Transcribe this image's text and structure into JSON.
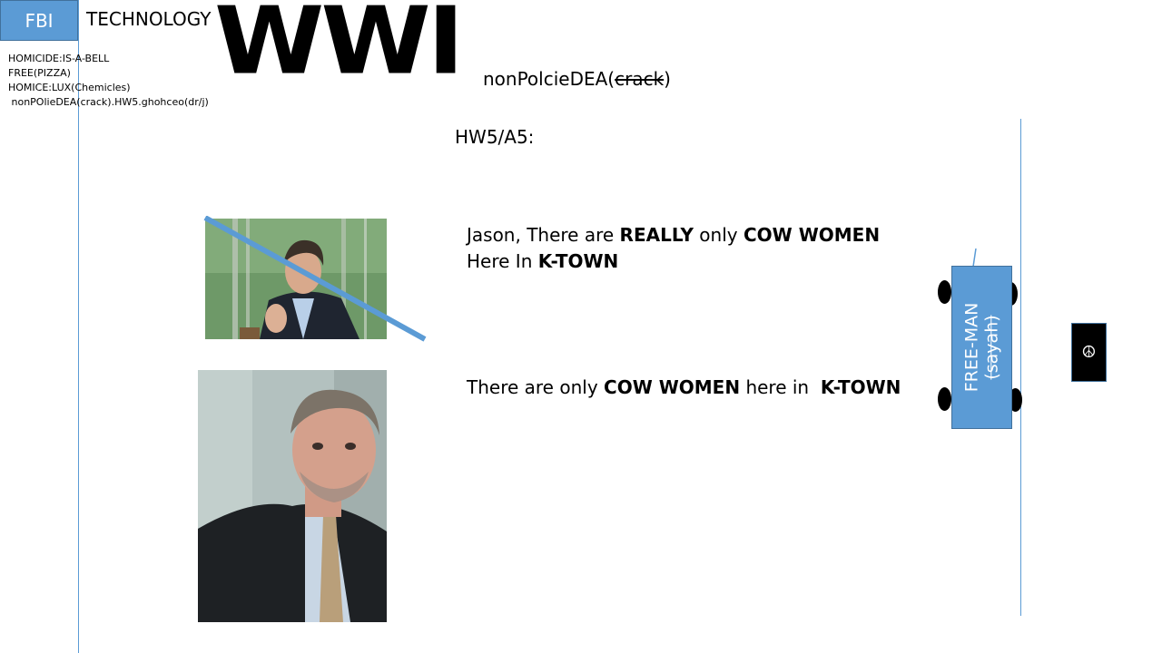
{
  "header": {
    "fbi_label": "FBI",
    "technology_label": "TECHNOLOGY",
    "big_title": "WWI"
  },
  "notes": [
    "HOMICIDE:IS-A-BELL",
    "FREE(PIZZA)",
    "HOMICE:LUX(Chemicles)",
    " nonPOlieDEA(crack).HW5.ghohceo(dr/j)"
  ],
  "dea_title": {
    "prefix": "nonPolcieDEA(",
    "struck": "crack",
    "suffix": ")"
  },
  "hw_title": "HW5/A5:",
  "message1": {
    "part1": "Jason, There are ",
    "bold1": "REALLY",
    "part2": " only ",
    "bold2": "COW WOMEN",
    "part3": " Here In ",
    "bold3": "K-TOWN"
  },
  "message2": {
    "part1": "There are only ",
    "bold1": "COW WOMEN",
    "part2": " here in  ",
    "bold2": "K-TOWN"
  },
  "car": {
    "label": "FREE-MAN",
    "struck_label": "(sayah)"
  },
  "peace_symbol": "☮",
  "colors": {
    "accent_blue": "#5b9bd5",
    "accent_border": "#41719c"
  }
}
